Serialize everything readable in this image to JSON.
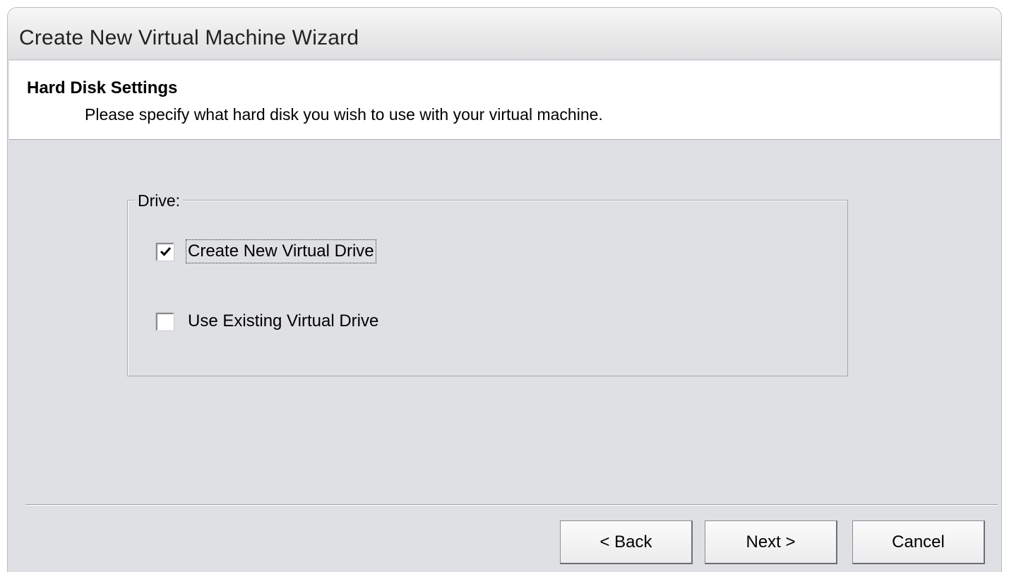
{
  "window": {
    "title": "Create New Virtual Machine Wizard"
  },
  "header": {
    "title": "Hard Disk Settings",
    "subtitle": "Please specify what hard disk you wish to use with your virtual machine."
  },
  "drive_group": {
    "legend": "Drive:",
    "options": [
      {
        "label": "Create New Virtual Drive",
        "checked": true
      },
      {
        "label": "Use Existing Virtual Drive",
        "checked": false
      }
    ]
  },
  "buttons": {
    "back": "< Back",
    "next": "Next >",
    "cancel": "Cancel"
  }
}
